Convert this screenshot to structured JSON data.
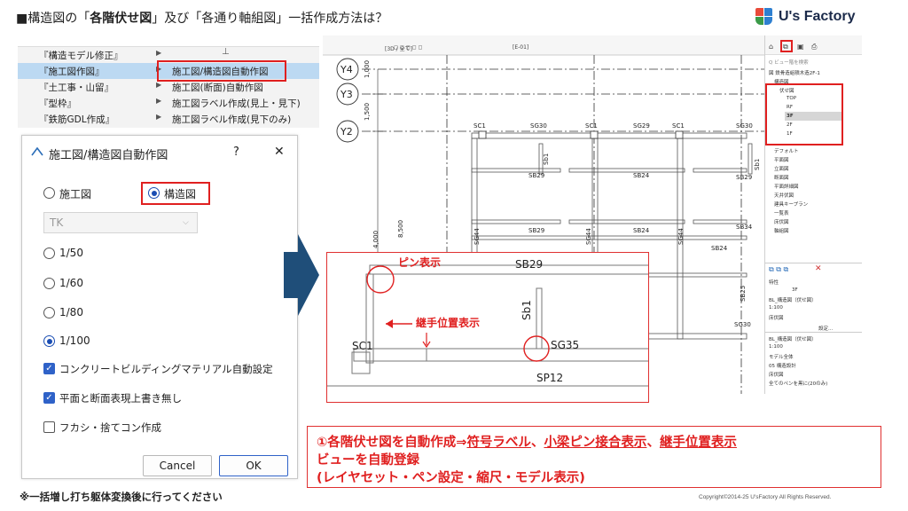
{
  "header": {
    "title_prefix": "■構造図の「",
    "title_bold": "各階伏せ図",
    "title_suffix": "」及び「各通り軸組図」一括作成方法は？",
    "logo_text": "U's Factory"
  },
  "menu": {
    "rows": [
      {
        "left": "『構造モデル修正』",
        "right": ""
      },
      {
        "left": "『施工図作図』",
        "right": "施工図/構造図自動作図"
      },
      {
        "left": "『土工事・山留』",
        "right": "施工図(断面)自動作図"
      },
      {
        "left": "『型枠』",
        "right": "施工図ラベル作成(見上・見下)"
      },
      {
        "left": "『鉄筋GDL作成』",
        "right": "施工図ラベル作成(見下のみ)"
      }
    ]
  },
  "dialog": {
    "title": "施工図/構造図自動作図",
    "help": "?",
    "close": "✕",
    "opt_construction": "施工図",
    "opt_structure": "構造図",
    "dropdown_value": "TK",
    "scales": [
      "1/50",
      "1/60",
      "1/80",
      "1/100"
    ],
    "checkboxes": [
      {
        "label": "コンクリートビルディングマテリアル自動設定",
        "checked": true
      },
      {
        "label": "平面と断面表現上書き無し",
        "checked": true
      },
      {
        "label": "フカシ・捨てコン作成",
        "checked": false
      }
    ],
    "cancel": "Cancel",
    "ok": "OK"
  },
  "cad": {
    "toolbar_left": "[3D / 全て]",
    "toolbar_right": "[E-01]",
    "axes": [
      "Y4",
      "Y3",
      "Y2"
    ],
    "dims": [
      "1,000",
      "1,500",
      "4,000",
      "8,500"
    ],
    "columns": [
      "SC1",
      "SC1",
      "SC1"
    ],
    "beams_row1": [
      "SG30",
      "SG29",
      "SG30"
    ],
    "beam_labels": [
      "SB29",
      "SB24",
      "SB29",
      "SB29",
      "SB24",
      "SB34",
      "SB24",
      "SB25",
      "SG30"
    ],
    "vert_labels": [
      "Sb1",
      "SG44",
      "SG44",
      "SG44",
      "Sb1"
    ]
  },
  "panel": {
    "search": "Q ビュー階を検索",
    "items": [
      "図 鉄骨造組積木造2F-1",
      "構造図",
      "伏せ図",
      "TOP",
      "RF",
      "3F",
      "2F",
      "1F",
      "デフォルト",
      "平面図",
      "立面図",
      "断面図",
      "平面詳細図",
      "天井伏図",
      "建具キープラン",
      "一覧表",
      "床伏図",
      "軸組図"
    ],
    "prop_header": "特性",
    "prop_value": "3F",
    "props": [
      "BL_構造図（伏せ図）",
      "1:100",
      "床伏図"
    ],
    "settings_btn": "設定...",
    "bottom": [
      "BL_構造図（伏せ図）",
      "1:100",
      "モデル全体",
      "05 構造設計",
      "床伏図",
      "全てのペンを黒に(20のみ)"
    ]
  },
  "zoom": {
    "pin_label": "ピン表示",
    "joint_label": "継手位置表示",
    "beam_top": "SB29",
    "col": "SC1",
    "vert": "Sb1",
    "girder": "SG35",
    "bottom": "SP12"
  },
  "notes": {
    "line1_a": "①各階伏せ図を自動作成⇒",
    "line1_b": "符号ラベル",
    "line1_c": "、",
    "line1_d": "小梁ピン接合表示",
    "line1_e": "、",
    "line1_f": "継手位置表示",
    "line2": "ビューを自動登録",
    "line3": "(レイヤセット・ペン設定・縮尺・モデル表示)"
  },
  "footnote": "※一括増し打ち躯体変換後に行ってください",
  "copyright": "Copyright©2014-25  U'sFactory All Rights Reserved."
}
